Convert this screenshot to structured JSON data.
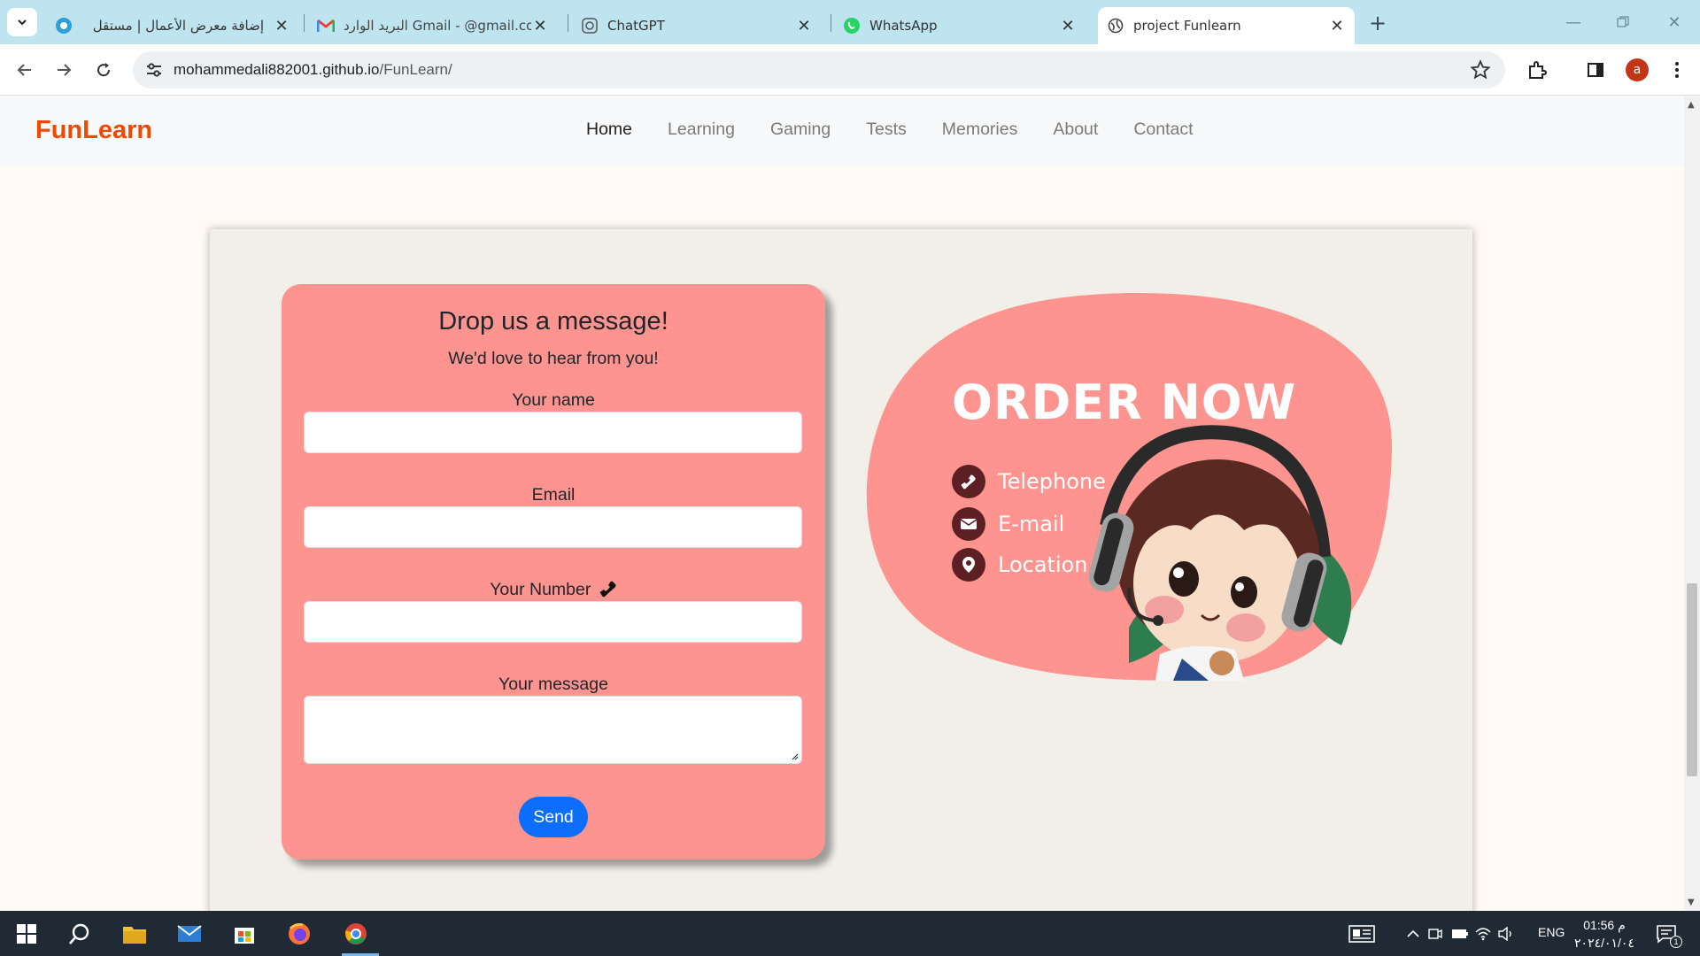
{
  "browser": {
    "tabs": [
      {
        "title": "إضافة معرض الأعمال | مستقل",
        "icon": "mostaql-icon"
      },
      {
        "title": "البريد الوارد Gmail - @gmail.com",
        "icon": "gmail-icon"
      },
      {
        "title": "ChatGPT",
        "icon": "chatgpt-icon"
      },
      {
        "title": "WhatsApp",
        "icon": "whatsapp-icon"
      },
      {
        "title": "project Funlearn",
        "icon": "globe-icon",
        "active": true
      }
    ],
    "url_host": "mohammedali882001.github.io",
    "url_path": "/FunLearn/",
    "profile_initial": "a"
  },
  "site": {
    "brand": "FunLearn",
    "nav": [
      "Home",
      "Learning",
      "Gaming",
      "Tests",
      "Memories",
      "About",
      "Contact"
    ],
    "active_nav": "Home"
  },
  "contact_form": {
    "title": "Drop us a message!",
    "subtitle": "We'd love to hear from you!",
    "name_label": "Your name",
    "email_label": "Email",
    "number_label": "Your Number",
    "message_label": "Your message",
    "name_value": "",
    "email_value": "",
    "number_value": "",
    "message_value": "",
    "send_label": "Send"
  },
  "order_graphic": {
    "title": "ORDER NOW",
    "items": [
      "Telephone",
      "E-mail",
      "Location"
    ]
  },
  "taskbar": {
    "language": "ENG",
    "time": "01:56 م",
    "date": "٢٠٢٤/٠١/٠٤",
    "notification_count": "1"
  },
  "colors": {
    "brand": "#f04a00",
    "form_bg": "#fe9490",
    "send": "#0d6efd",
    "blob": "#fe9490",
    "tabbar": "#bde4ef",
    "taskbar": "#1f2a35"
  }
}
